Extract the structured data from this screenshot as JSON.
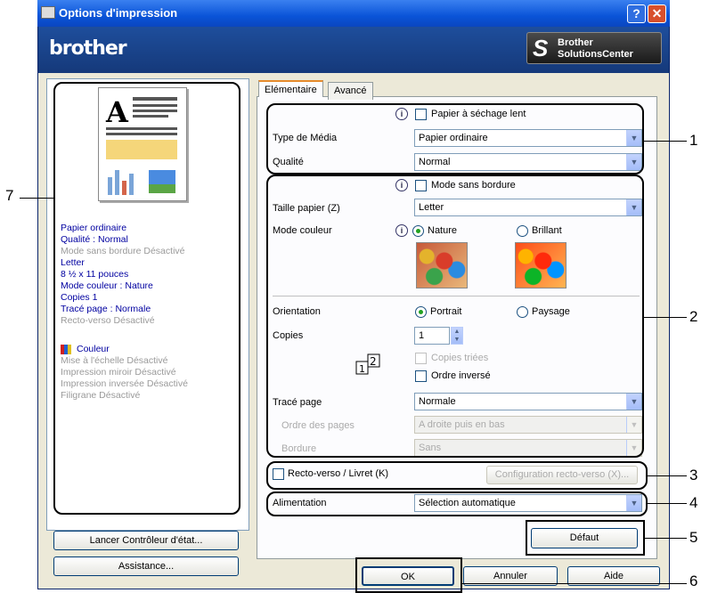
{
  "window": {
    "title": "Options d'impression",
    "help_label": "?",
    "close_label": "✕"
  },
  "brand": {
    "logo": "brother",
    "solutions_line1": "Brother",
    "solutions_line2": "SolutionsCenter"
  },
  "summary": {
    "items": [
      {
        "text": "Papier ordinaire",
        "active": true
      },
      {
        "text": "Qualité : Normal",
        "active": true
      },
      {
        "text": "Mode sans bordure Désactivé",
        "active": false
      },
      {
        "text": "Letter",
        "active": true
      },
      {
        "text": "8 ½ x 11 pouces",
        "active": true
      },
      {
        "text": "Mode couleur : Nature",
        "active": true
      },
      {
        "text": "Copies 1",
        "active": true
      },
      {
        "text": "Tracé page : Normale",
        "active": true
      },
      {
        "text": "Recto-verso Désactivé",
        "active": false
      }
    ],
    "couleur": "Couleur",
    "items2": [
      "Mise à l'échelle Désactivé",
      "Impression miroir Désactivé",
      "Impression inversée Désactivé",
      "Filigrane Désactivé"
    ]
  },
  "left_buttons": {
    "status_monitor": "Lancer Contrôleur d'état...",
    "support": "Assistance..."
  },
  "tabs": [
    {
      "label": "Elémentaire"
    },
    {
      "label": "Avancé"
    }
  ],
  "basic": {
    "slow_dry": "Papier à séchage lent",
    "media_label": "Type de Média",
    "media_value": "Papier ordinaire",
    "quality_label": "Qualité",
    "quality_value": "Normal",
    "borderless": "Mode sans bordure",
    "paper_size_label": "Taille papier (Z)",
    "paper_size_value": "Letter",
    "color_mode_label": "Mode couleur",
    "color_nature": "Nature",
    "color_vivid": "Brillant",
    "orientation_label": "Orientation",
    "portrait": "Portrait",
    "landscape": "Paysage",
    "copies_label": "Copies",
    "copies_value": "1",
    "collate": "Copies triées",
    "reverse_order": "Ordre inversé",
    "page_layout_label": "Tracé page",
    "page_layout_value": "Normale",
    "page_order_label": "Ordre des pages",
    "page_order_value": "A droite puis en bas",
    "border_label": "Bordure",
    "border_value": "Sans",
    "duplex": "Recto-verso / Livret (K)",
    "duplex_settings": "Configuration recto-verso (X)...",
    "paper_source_label": "Alimentation",
    "paper_source_value": "Sélection automatique",
    "default_button": "Défaut"
  },
  "footer": {
    "ok": "OK",
    "cancel": "Annuler",
    "help": "Aide"
  },
  "callouts": [
    "1",
    "2",
    "3",
    "4",
    "5",
    "6",
    "7"
  ]
}
